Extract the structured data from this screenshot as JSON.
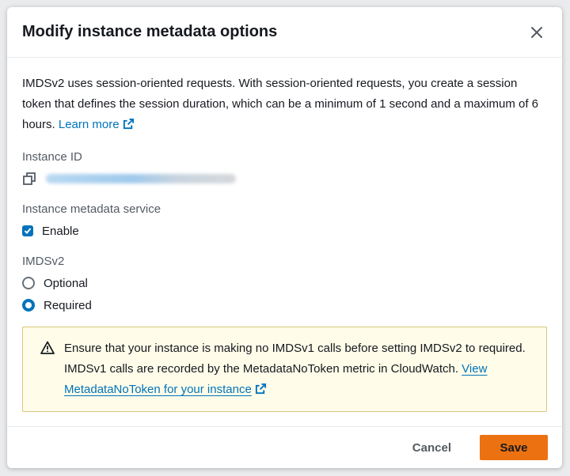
{
  "modal": {
    "title": "Modify instance metadata options",
    "description": "IMDSv2 uses session-oriented requests. With session-oriented requests, you create a session token that defines the session duration, which can be a minimum of 1 second and a maximum of 6 hours.",
    "learn_more": "Learn more"
  },
  "instance_id": {
    "label": "Instance ID"
  },
  "metadata_service": {
    "label": "Instance metadata service",
    "enable_label": "Enable",
    "enabled": true
  },
  "imdsv2": {
    "label": "IMDSv2",
    "options": [
      "Optional",
      "Required"
    ],
    "selected": "Required"
  },
  "alert": {
    "text": "Ensure that your instance is making no IMDSv1 calls before setting IMDSv2 to required. IMDSv1 calls are recorded by the MetadataNoToken metric in CloudWatch.",
    "link": "View MetadataNoToken for your instance"
  },
  "footer": {
    "cancel_label": "Cancel",
    "save_label": "Save"
  },
  "colors": {
    "accent": "#0073bb",
    "primary_button": "#ec7211",
    "warning_bg": "#fffce9",
    "warning_border": "#d8c77a"
  }
}
